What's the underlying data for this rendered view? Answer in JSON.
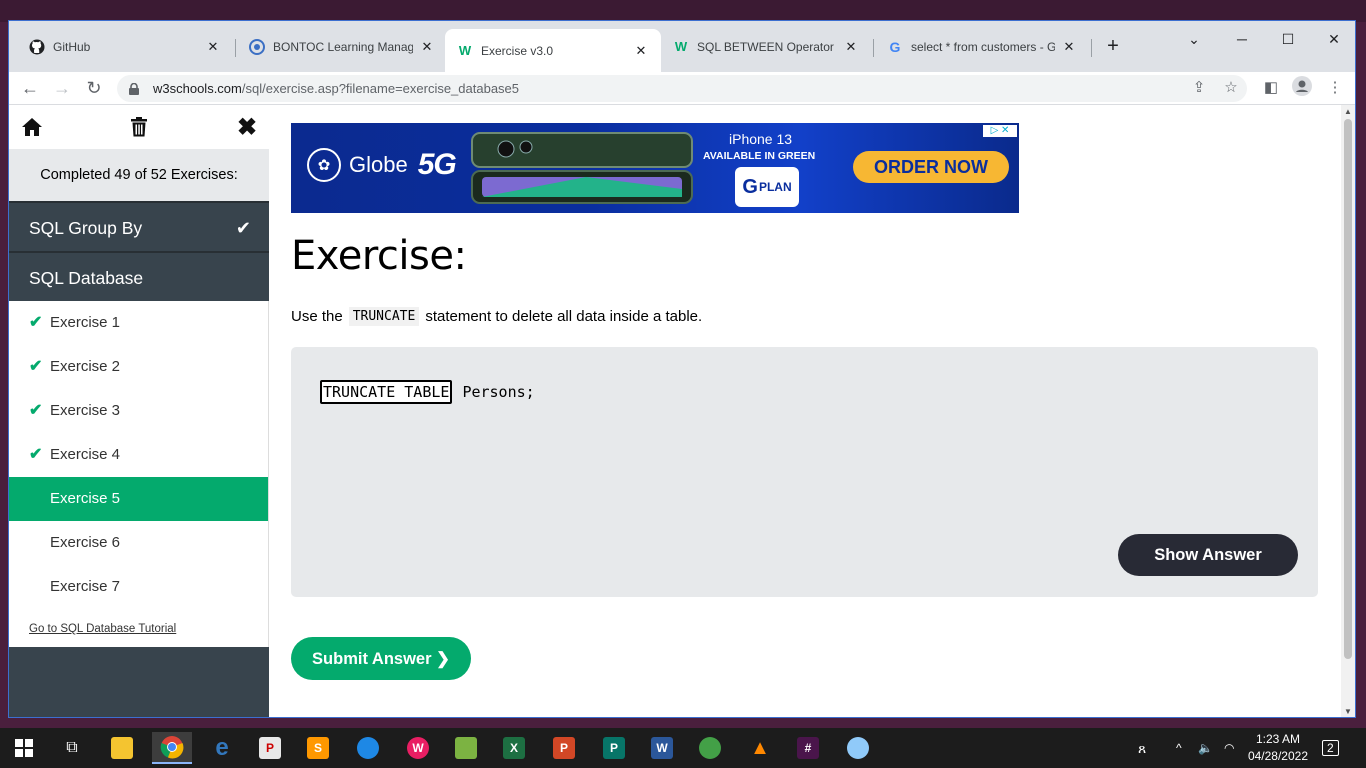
{
  "browser": {
    "tabs": [
      {
        "title": "GitHub",
        "icon": "github-icon"
      },
      {
        "title": "BONTOC Learning Managem",
        "icon": "moodle-icon"
      },
      {
        "title": "Exercise v3.0",
        "icon": "w3schools-icon",
        "active": true
      },
      {
        "title": "SQL BETWEEN Operator",
        "icon": "w3schools-icon"
      },
      {
        "title": "select * from customers - Go",
        "icon": "google-icon"
      }
    ],
    "url_host": "w3schools.com",
    "url_path": "/sql/exercise.asp?filename=exercise_database5"
  },
  "sidebar": {
    "progress": "Completed 49 of 52 Exercises:",
    "completed_section": "SQL Group By",
    "current_section": "SQL Database",
    "items": [
      {
        "label": "Exercise 1",
        "done": true
      },
      {
        "label": "Exercise 2",
        "done": true
      },
      {
        "label": "Exercise 3",
        "done": true
      },
      {
        "label": "Exercise 4",
        "done": true
      },
      {
        "label": "Exercise 5",
        "active": true
      },
      {
        "label": "Exercise 6"
      },
      {
        "label": "Exercise 7"
      }
    ],
    "tutorial_link": "Go to SQL Database Tutorial"
  },
  "ad": {
    "brand": "Globe",
    "network": "5G",
    "product": "iPhone 13",
    "tagline": "AVAILABLE IN GREEN",
    "plan": "PLAN",
    "cta": "ORDER NOW"
  },
  "exercise": {
    "title": "Exercise:",
    "instruction_before": "Use the",
    "instruction_code": "TRUNCATE",
    "instruction_after": "statement to delete all data inside a table.",
    "answer_input": "TRUNCATE TABLE",
    "code_rest": "Persons;",
    "show_answer": "Show Answer",
    "submit": "Submit Answer ❯"
  },
  "taskbar": {
    "time": "1:23 AM",
    "date": "04/28/2022",
    "notifications": "2"
  },
  "colors": {
    "accent_green": "#04aa6d",
    "sidebar_dark": "#38444d",
    "button_dark": "#282a35"
  }
}
